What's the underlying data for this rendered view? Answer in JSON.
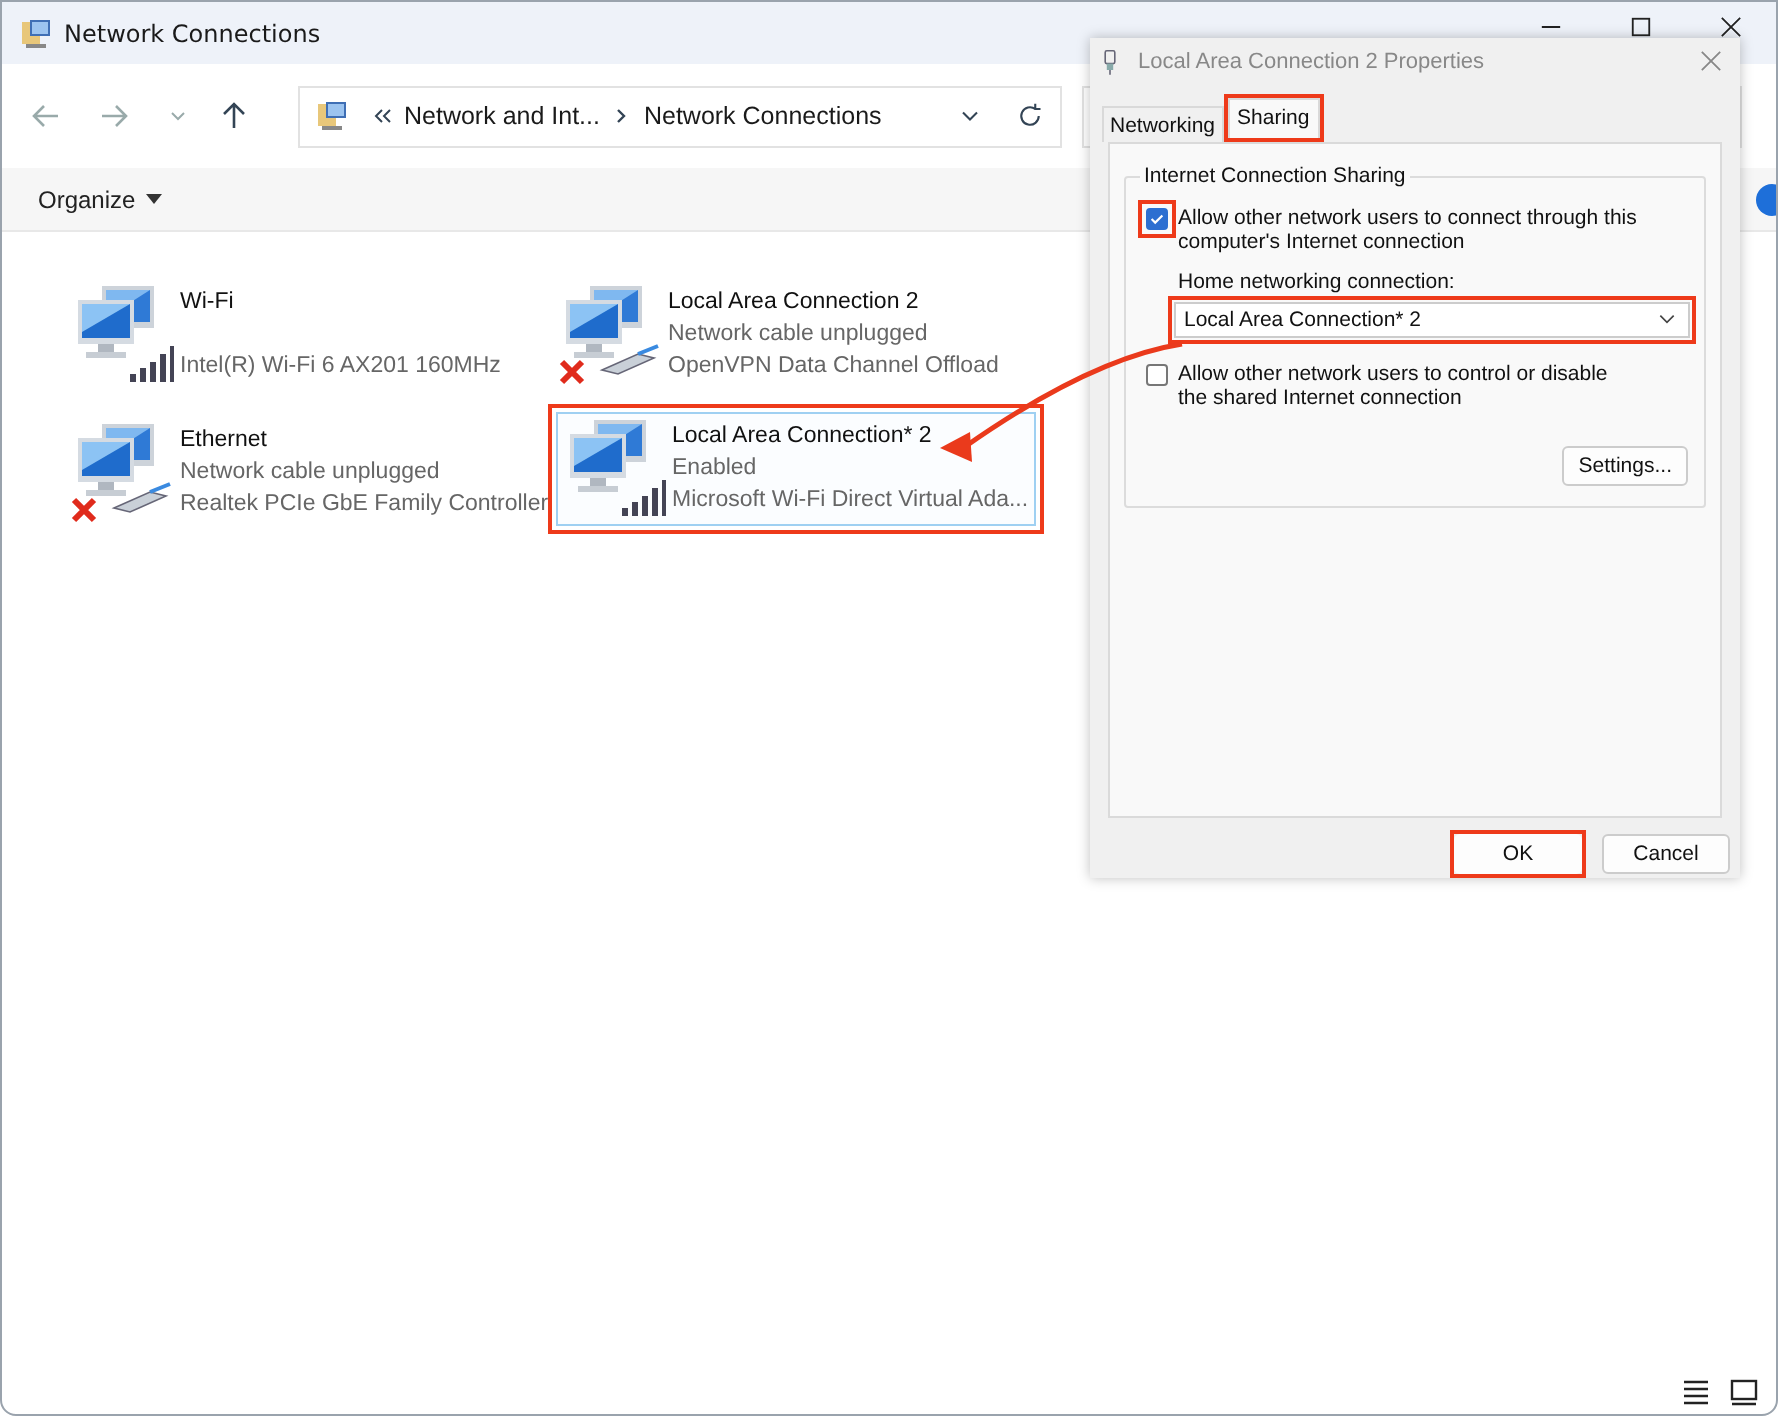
{
  "window": {
    "title": "Network Connections"
  },
  "address_bar": {
    "crumbs": [
      "Network and Int...",
      "Network Connections"
    ]
  },
  "toolbar": {
    "organize": "Organize"
  },
  "connections": [
    {
      "name": "Wi-Fi",
      "device": "Intel(R) Wi-Fi 6 AX201 160MHz",
      "kind": "signal",
      "selected": false,
      "annotated": false
    },
    {
      "name": "Local Area Connection 2",
      "status": "Network cable unplugged",
      "device": "OpenVPN Data Channel Offload",
      "kind": "unplugged",
      "selected": false,
      "annotated": false
    },
    {
      "name": "Ethernet",
      "status": "Network cable unplugged",
      "device": "Realtek PCIe GbE Family Controller",
      "kind": "unplugged",
      "selected": false,
      "annotated": false
    },
    {
      "name": "Local Area Connection* 2",
      "status": "Enabled",
      "device": "Microsoft Wi-Fi Direct Virtual Ada...",
      "kind": "signal",
      "selected": true,
      "annotated": true
    }
  ],
  "dialog": {
    "title": "Local Area Connection 2 Properties",
    "tabs": [
      {
        "label": "Networking",
        "selected": false,
        "annotated": false
      },
      {
        "label": "Sharing",
        "selected": true,
        "annotated": true
      }
    ],
    "group_title": "Internet Connection Sharing",
    "options": [
      {
        "label": "Allow other network users to connect through this computer's Internet connection",
        "checked": true,
        "annotated": true
      },
      {
        "label": "Allow other network users to control or disable the shared Internet connection",
        "checked": false,
        "annotated": false
      }
    ],
    "home_label": "Home networking connection:",
    "home_value": "Local Area Connection* 2",
    "home_annotated": true,
    "settings_button": "Settings...",
    "buttons": [
      {
        "label": "OK",
        "annotated": true
      },
      {
        "label": "Cancel",
        "annotated": false
      }
    ]
  }
}
